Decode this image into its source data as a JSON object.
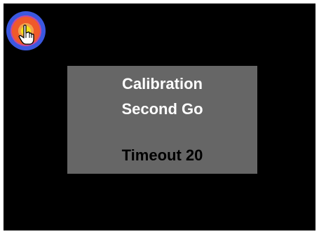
{
  "calibration_dialog": {
    "title": "Calibration",
    "subtitle": "Second Go",
    "timeout_text": "Timeout 20"
  },
  "icons": {
    "target": "calibration-target-icon",
    "cursor": "hand-pointer-cursor-icon"
  },
  "colors": {
    "screen_background": "#000000",
    "dialog_background": "#666666",
    "title_text": "#ffffff",
    "timeout_text": "#000000",
    "target_rings": [
      "#f5e21c",
      "#f2a24a",
      "#ef5a2a",
      "#c04aa0",
      "#3b58e0"
    ]
  }
}
